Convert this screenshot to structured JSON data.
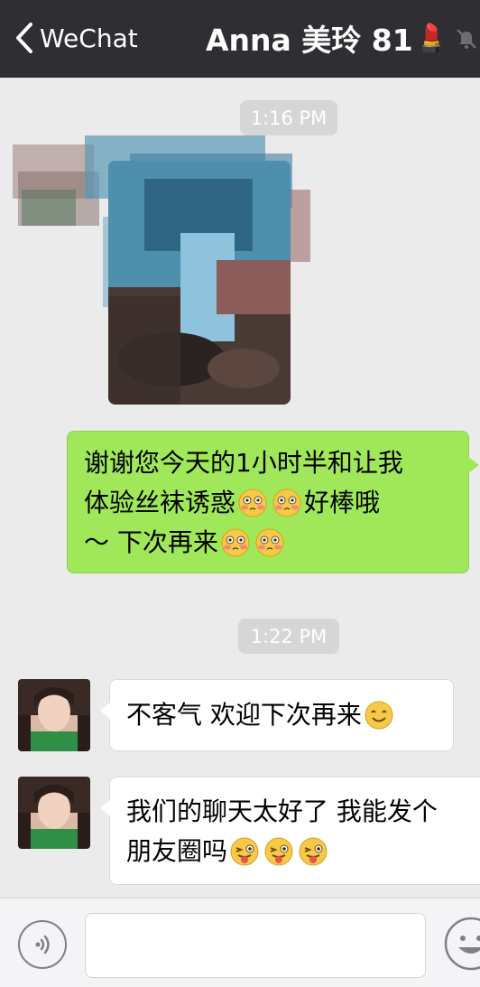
{
  "header": {
    "back_label": "WeChat",
    "title": "Anna 美玲 81",
    "title_emoji": "💄",
    "mute_icon": "bell-muted-icon",
    "background": "#2e2e33"
  },
  "messages": {
    "time_1": "1:16 PM",
    "time_2": "1:22 PM",
    "image_message": {
      "type": "photo",
      "note": ""
    },
    "sent_1": {
      "line_1": "谢谢您今天的1小时半和让我",
      "line_2a": "体验丝袜诱惑",
      "line_2b": " 好棒哦",
      "line_3": "～ 下次再来 ",
      "emoji": "shy-face-emoji"
    },
    "recv_1": {
      "text": "不客气 欢迎下次再来",
      "emoji": "smile-emoji"
    },
    "recv_2": {
      "line_1": "我们的聊天太好了 我能发个",
      "line_2": "朋友圈吗",
      "emoji": "tongue-wink-emoji"
    }
  },
  "input_bar": {
    "voice_icon": "voice-icon",
    "placeholder": "",
    "emoji_icon": "emoji-face-icon"
  },
  "colors": {
    "chat_bg": "#ebebeb",
    "sent_bubble": "#a0e75a",
    "recv_bubble": "#ffffff",
    "time_pill": "#d6d6d6"
  }
}
